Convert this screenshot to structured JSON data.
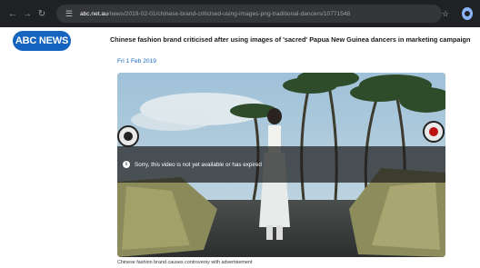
{
  "browser": {
    "url_host": "abc.net.au",
    "url_path": "/news/2019-02-01/chinese-brand-criticised-using-images-png-traditional-dancers/10771548"
  },
  "header": {
    "logo_text": "ABC NEWS",
    "headline": "Chinese fashion brand criticised after using images of 'sacred' Papua New Guinea dancers in marketing campaign"
  },
  "article": {
    "date": "Fri 1 Feb 2019",
    "video_error": "Sorry, this video is not yet available or has expired",
    "caption": "Chinese fashion brand causes controversy with advertisement"
  },
  "colors": {
    "abc_blue": "#1565c0",
    "chrome_dark": "#202124"
  }
}
